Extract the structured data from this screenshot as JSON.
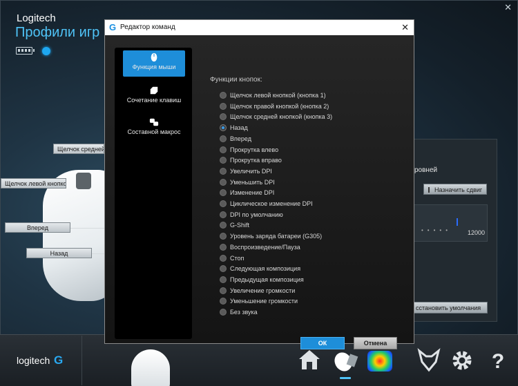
{
  "app": {
    "brand": "Logitech",
    "title": "Профили игр Lo",
    "close_glyph": "✕"
  },
  "callouts": {
    "middle_click": "Щелчок средней к",
    "left_click": "Щелчок левой кнопкой",
    "forward": "Вперед",
    "back": "Назад"
  },
  "right_panel": {
    "levels_text": "ровней",
    "shift_button": "Назначить сдвиг",
    "dpi_value": "12000",
    "restore_button": "сстановить умолчания"
  },
  "bottom_bar": {
    "brand": "logitech",
    "brand_mark": "G",
    "icons": [
      "home-icon",
      "mouse-customize-icon",
      "heatmap-icon",
      "arx-fox-icon",
      "gear-icon",
      "help-icon"
    ],
    "help_glyph": "?"
  },
  "dialog": {
    "title": "Редактор команд",
    "close_glyph": "✕",
    "sidebar": [
      {
        "label": "Функция мыши",
        "icon": "mouse-icon",
        "active": true
      },
      {
        "label": "Сочетание клавиш",
        "icon": "key-combo-icon",
        "active": false
      },
      {
        "label": "Составной макрос",
        "icon": "macro-icon",
        "active": false
      }
    ],
    "functions_heading": "Функции кнопок:",
    "functions": [
      "Щелчок левой кнопкой (кнопка 1)",
      "Щелчок правой кнопкой (кнопка 2)",
      "Щелчок средней кнопкой (кнопка 3)",
      "Назад",
      "Вперед",
      "Прокрутка влево",
      "Прокрутка вправо",
      "Увеличить DPI",
      "Уменьшить DPI",
      "Изменение DPI",
      "Циклическое изменение DPI",
      "DPI по умолчанию",
      "G-Shift",
      "Уровень заряда батареи (G305)",
      "Воспроизведение/Пауза",
      "Стоп",
      "Следующая композиция",
      "Предыдущая композиция",
      "Увеличение громкости",
      "Уменьшение громкости",
      "Без звука"
    ],
    "selected_function": "Назад",
    "ok_label": "ОК",
    "cancel_label": "Отмена"
  },
  "colors": {
    "accent": "#1e8ed9",
    "title_blue": "#4fc3f7",
    "dialog_bg": "#1e1e1e"
  }
}
